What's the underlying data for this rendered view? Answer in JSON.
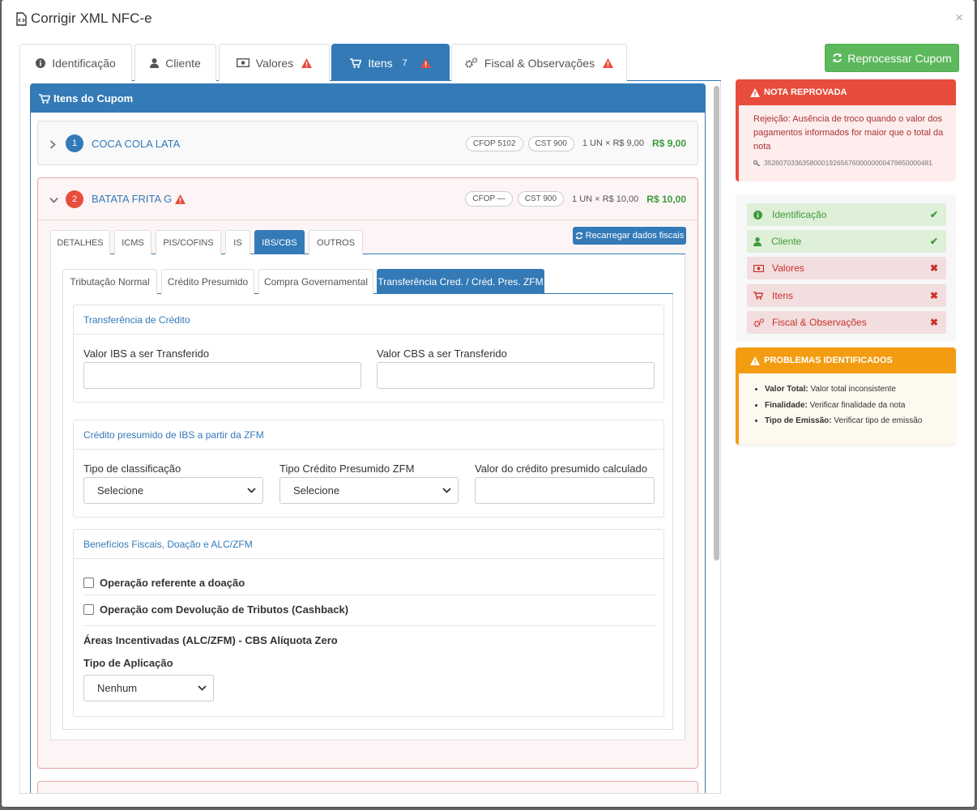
{
  "window": {
    "title": "Corrigir XML NFC-e",
    "close": "×"
  },
  "tabs": [
    {
      "label": "Identificação"
    },
    {
      "label": "Cliente"
    },
    {
      "label": "Valores"
    },
    {
      "label": "Itens",
      "count": "7"
    },
    {
      "label": "Fiscal & Observações"
    }
  ],
  "reprocess_label": "Reprocessar Cupom",
  "items_panel_title": "Itens do Cupom",
  "items": [
    {
      "num": "1",
      "name": "COCA COLA LATA",
      "cfop": "CFOP 5102",
      "cst": "CST 900",
      "qty": "1 UN × R$ 9,00",
      "total": "R$ 9,00"
    },
    {
      "num": "2",
      "name": "BATATA FRITA G",
      "cfop": "CFOP —",
      "cst": "CST 900",
      "qty": "1 UN × R$ 10,00",
      "total": "R$ 10,00"
    }
  ],
  "inner_tabs": [
    "DETALHES",
    "ICMS",
    "PIS/COFINS",
    "IS",
    "IBS/CBS",
    "OUTROS"
  ],
  "reload_label": "Recarregar dados fiscais",
  "sub_tabs": [
    "Tributação Normal",
    "Crédito Presumido",
    "Compra Governamental",
    "Transferência Cred. / Créd. Pres. ZFM"
  ],
  "transfer": {
    "title": "Transferência de Crédito",
    "ibs_label": "Valor IBS a ser Transferido",
    "cbs_label": "Valor CBS a ser Transferido"
  },
  "zfm": {
    "title": "Crédito presumido de IBS a partir da ZFM",
    "class_label": "Tipo de classificação",
    "class_value": "Selecione",
    "credit_label": "Tipo Crédito Presumido ZFM",
    "credit_value": "Selecione",
    "calc_label": "Valor do crédito presumido calculado"
  },
  "benefits": {
    "title": "Benefícios Fiscais, Doação e ALC/ZFM",
    "donation": "Operação referente a doação",
    "cashback": "Operação com Devolução de Tributos (Cashback)",
    "areas": "Áreas Incentivadas (ALC/ZFM) - CBS Alíquota Zero",
    "app_label": "Tipo de Aplicação",
    "app_value": "Nenhum"
  },
  "note": {
    "title": "NOTA REPROVADA",
    "text": "Rejeição: Ausência de troco quando o valor dos pagamentos informados for maior que o total da nota",
    "key": "35260703363580001926567600000000479650000481"
  },
  "status": [
    {
      "label": "Identificação",
      "state": "ok"
    },
    {
      "label": "Cliente",
      "state": "ok"
    },
    {
      "label": "Valores",
      "state": "bad"
    },
    {
      "label": "Itens",
      "state": "bad"
    },
    {
      "label": "Fiscal & Observações",
      "state": "bad"
    }
  ],
  "problems": {
    "title": "PROBLEMAS IDENTIFICADOS",
    "list": [
      {
        "key": "Valor Total:",
        "text": "Valor total inconsistente"
      },
      {
        "key": "Finalidade:",
        "text": "Verificar finalidade da nota"
      },
      {
        "key": "Tipo de Emissão:",
        "text": "Verificar tipo de emissão"
      }
    ]
  },
  "colors": {
    "primary": "#337ab7",
    "success": "#5cb85c",
    "danger": "#e74c3c",
    "warning": "#f39c12"
  }
}
